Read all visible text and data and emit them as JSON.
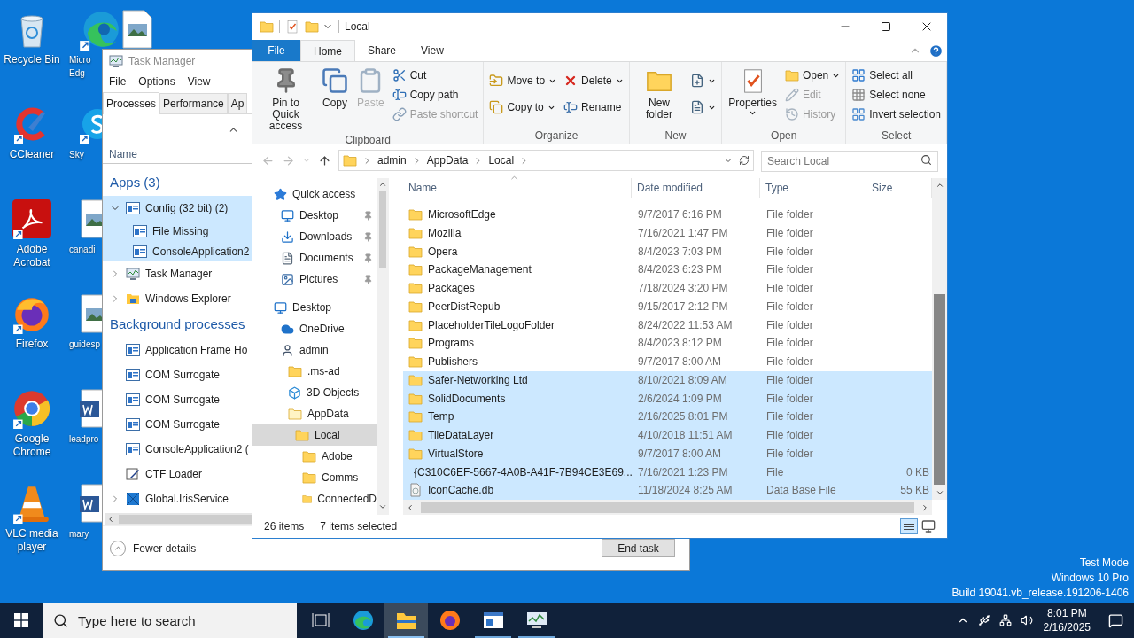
{
  "desktop": {
    "columns": [
      [
        {
          "label": "Recycle Bin",
          "kind": "recycle"
        },
        {
          "label": "CCleaner",
          "kind": "ccleaner"
        },
        {
          "label": "Adobe Acrobat",
          "kind": "acrobat"
        },
        {
          "label": "Firefox",
          "kind": "firefox"
        },
        {
          "label": "Google Chrome",
          "kind": "chrome"
        },
        {
          "label": "VLC media player",
          "kind": "vlc"
        }
      ],
      [
        {
          "label": "Micro Edg",
          "kind": "edge"
        },
        {
          "label": "Sky",
          "kind": "skype"
        },
        {
          "label": "canadi",
          "kind": "image"
        },
        {
          "label": "guidesp",
          "kind": "image"
        },
        {
          "label": "leadpro",
          "kind": "word"
        },
        {
          "label": "mary",
          "kind": "word"
        }
      ],
      [
        {
          "kind": "image"
        }
      ]
    ]
  },
  "task_manager": {
    "title": "Task Manager",
    "menu": [
      "File",
      "Options",
      "View"
    ],
    "tabs": [
      {
        "label": "Processes",
        "selected": true
      },
      {
        "label": "Performance",
        "selected": false
      },
      {
        "label": "Ap",
        "selected": false
      }
    ],
    "column": "Name",
    "sections": [
      {
        "title": "Apps (3)",
        "items": [
          {
            "name": "Config (32 bit) (2)",
            "kind": "app",
            "expandable": true,
            "expanded": true,
            "selected": true,
            "children": [
              {
                "name": "File Missing",
                "kind": "app"
              },
              {
                "name": "ConsoleApplication2",
                "kind": "app"
              }
            ]
          },
          {
            "name": "Task Manager",
            "kind": "taskmgr",
            "expandable": true,
            "expanded": false,
            "selected": false
          },
          {
            "name": "Windows Explorer",
            "kind": "explorer",
            "expandable": true,
            "expanded": false,
            "selected": false
          }
        ]
      },
      {
        "title": "Background processes",
        "items": [
          {
            "name": "Application Frame Ho",
            "kind": "app",
            "expandable": false,
            "expanded": false,
            "selected": false
          },
          {
            "name": "COM Surrogate",
            "kind": "app",
            "expandable": false,
            "expanded": false,
            "selected": false
          },
          {
            "name": "COM Surrogate",
            "kind": "app",
            "expandable": false,
            "expanded": false,
            "selected": false
          },
          {
            "name": "COM Surrogate",
            "kind": "app",
            "expandable": false,
            "expanded": false,
            "selected": false
          },
          {
            "name": "ConsoleApplication2 (",
            "kind": "app",
            "expandable": false,
            "expanded": false,
            "selected": false
          },
          {
            "name": "CTF Loader",
            "kind": "ctf",
            "expandable": false,
            "expanded": false,
            "selected": false
          },
          {
            "name": "Global.IrisService",
            "kind": "iris",
            "expandable": true,
            "expanded": false,
            "selected": false
          }
        ]
      }
    ],
    "footer": {
      "toggle": "Fewer details",
      "button": "End task"
    }
  },
  "explorer": {
    "title": "Local",
    "tabs": [
      {
        "label": "File",
        "kind": "file",
        "selected": false
      },
      {
        "label": "Home",
        "kind": "tab",
        "selected": true
      },
      {
        "label": "Share",
        "kind": "tab",
        "selected": false
      },
      {
        "label": "View",
        "kind": "tab",
        "selected": false
      }
    ],
    "ribbon": [
      {
        "label": "Clipboard",
        "large": [
          {
            "label": "Pin to Quick access",
            "kind": "pin",
            "disabled": false,
            "dropdown": false
          },
          {
            "label": "Copy",
            "kind": "copy",
            "disabled": false,
            "dropdown": false
          },
          {
            "label": "Paste",
            "kind": "paste",
            "disabled": true,
            "dropdown": false
          }
        ],
        "small": [
          [
            {
              "label": "Cut",
              "kind": "cut",
              "disabled": false,
              "dropdown": false
            },
            {
              "label": "Copy path",
              "kind": "path",
              "disabled": false,
              "dropdown": false
            },
            {
              "label": "Paste shortcut",
              "kind": "shortcut",
              "disabled": true,
              "dropdown": false
            }
          ]
        ]
      },
      {
        "label": "Organize",
        "small": [
          [
            {
              "label": "Move to",
              "kind": "move",
              "disabled": false,
              "dropdown": true
            },
            {
              "label": "Copy to",
              "kind": "copyto",
              "disabled": false,
              "dropdown": true
            }
          ],
          [
            {
              "label": "Delete",
              "kind": "delete",
              "disabled": false,
              "dropdown": true
            },
            {
              "label": "Rename",
              "kind": "rename",
              "disabled": false,
              "dropdown": false
            }
          ]
        ]
      },
      {
        "label": "New",
        "large": [
          {
            "label": "New folder",
            "kind": "newfolder",
            "disabled": false,
            "dropdown": false
          }
        ],
        "small": [
          [
            {
              "kind": "newitem",
              "disabled": false,
              "dropdown": true
            },
            {
              "kind": "easyaccess",
              "disabled": false,
              "dropdown": true
            }
          ]
        ]
      },
      {
        "label": "Open",
        "large": [
          {
            "label": "Properties",
            "kind": "properties",
            "disabled": false,
            "dropdown": true
          }
        ],
        "small": [
          [
            {
              "label": "Open",
              "kind": "open",
              "disabled": false,
              "dropdown": true
            },
            {
              "label": "Edit",
              "kind": "edit",
              "disabled": true,
              "dropdown": false
            },
            {
              "label": "History",
              "kind": "history",
              "disabled": true,
              "dropdown": false
            }
          ]
        ]
      },
      {
        "label": "Select",
        "small": [
          [
            {
              "label": "Select all",
              "kind": "selectall",
              "disabled": false,
              "dropdown": false
            },
            {
              "label": "Select none",
              "kind": "selectnone",
              "disabled": false,
              "dropdown": false
            },
            {
              "label": "Invert selection",
              "kind": "invert",
              "disabled": false,
              "dropdown": false
            }
          ]
        ]
      }
    ],
    "address": {
      "crumbs": [
        "admin",
        "AppData",
        "Local"
      ]
    },
    "search": {
      "placeholder": "Search Local"
    },
    "nav": [
      {
        "label": "Quick access",
        "kind": "star",
        "pinned": false,
        "selected": false,
        "children": [
          {
            "label": "Desktop",
            "kind": "desktop",
            "pinned": true,
            "selected": false
          },
          {
            "label": "Downloads",
            "kind": "download",
            "pinned": true,
            "selected": false
          },
          {
            "label": "Documents",
            "kind": "documents",
            "pinned": true,
            "selected": false
          },
          {
            "label": "Pictures",
            "kind": "pictures",
            "pinned": true,
            "selected": false
          }
        ]
      },
      {
        "label": "Desktop",
        "kind": "desktop",
        "pinned": false,
        "selected": false,
        "children": [
          {
            "label": "OneDrive",
            "kind": "cloud",
            "pinned": false,
            "selected": false
          },
          {
            "label": "admin",
            "kind": "user",
            "pinned": false,
            "selected": false,
            "children": [
              {
                "label": ".ms-ad",
                "kind": "folder",
                "pinned": false,
                "selected": false
              },
              {
                "label": "3D Objects",
                "kind": "cube",
                "pinned": false,
                "selected": false
              },
              {
                "label": "AppData",
                "kind": "folderlight",
                "pinned": false,
                "selected": false,
                "children": [
                  {
                    "label": "Local",
                    "kind": "folder",
                    "pinned": false,
                    "selected": true,
                    "children": [
                      {
                        "label": "Adobe",
                        "kind": "folder",
                        "pinned": false,
                        "selected": false
                      },
                      {
                        "label": "Comms",
                        "kind": "folder",
                        "pinned": false,
                        "selected": false
                      },
                      {
                        "label": "ConnectedD",
                        "kind": "folder",
                        "pinned": false,
                        "selected": false
                      }
                    ]
                  }
                ]
              }
            ]
          }
        ]
      }
    ],
    "files": {
      "columns": [
        "Name",
        "Date modified",
        "Type",
        "Size"
      ],
      "rows": [
        {
          "name": "MicrosoftEdge",
          "date": "9/7/2017 6:16 PM",
          "type": "File folder",
          "kind": "folder",
          "selected": false
        },
        {
          "name": "Mozilla",
          "date": "7/16/2021 1:47 PM",
          "type": "File folder",
          "kind": "folder",
          "selected": false
        },
        {
          "name": "Opera",
          "date": "8/4/2023 7:03 PM",
          "type": "File folder",
          "kind": "folder",
          "selected": false
        },
        {
          "name": "PackageManagement",
          "date": "8/4/2023 6:23 PM",
          "type": "File folder",
          "kind": "folder",
          "selected": false
        },
        {
          "name": "Packages",
          "date": "7/18/2024 3:20 PM",
          "type": "File folder",
          "kind": "folder",
          "selected": false
        },
        {
          "name": "PeerDistRepub",
          "date": "9/15/2017 2:12 PM",
          "type": "File folder",
          "kind": "folder",
          "selected": false
        },
        {
          "name": "PlaceholderTileLogoFolder",
          "date": "8/24/2022 11:53 AM",
          "type": "File folder",
          "kind": "folder",
          "selected": false
        },
        {
          "name": "Programs",
          "date": "8/4/2023 8:12 PM",
          "type": "File folder",
          "kind": "folder",
          "selected": false
        },
        {
          "name": "Publishers",
          "date": "9/7/2017 8:00 AM",
          "type": "File folder",
          "kind": "folder",
          "selected": false
        },
        {
          "name": "Safer-Networking Ltd",
          "date": "8/10/2021 8:09 AM",
          "type": "File folder",
          "kind": "folder",
          "selected": true
        },
        {
          "name": "SolidDocuments",
          "date": "2/6/2024 1:09 PM",
          "type": "File folder",
          "kind": "folder",
          "selected": true
        },
        {
          "name": "Temp",
          "date": "2/16/2025 8:01 PM",
          "type": "File folder",
          "kind": "folder",
          "selected": true
        },
        {
          "name": "TileDataLayer",
          "date": "4/10/2018 11:51 AM",
          "type": "File folder",
          "kind": "folder",
          "selected": true
        },
        {
          "name": "VirtualStore",
          "date": "9/7/2017 8:00 AM",
          "type": "File folder",
          "kind": "folder",
          "selected": true
        },
        {
          "name": "{C310C6EF-5667-4A0B-A41F-7B94CE3E69...",
          "date": "7/16/2021 1:23 PM",
          "type": "File",
          "size": "0 KB",
          "kind": "file",
          "selected": true
        },
        {
          "name": "IconCache.db",
          "date": "11/18/2024 8:25 AM",
          "type": "Data Base File",
          "size": "55 KB",
          "kind": "db",
          "selected": true
        }
      ]
    },
    "status": {
      "count": "26 items",
      "selection": "7 items selected"
    }
  },
  "taskbar": {
    "search": {
      "placeholder": "Type here to search"
    },
    "apps": [
      {
        "kind": "taskview",
        "active": false,
        "running": false
      },
      {
        "kind": "edge",
        "active": false,
        "running": false
      },
      {
        "kind": "explorer",
        "active": true,
        "running": true
      },
      {
        "kind": "firefox",
        "active": false,
        "running": false
      },
      {
        "kind": "window",
        "active": false,
        "running": true
      },
      {
        "kind": "taskmgr",
        "active": false,
        "running": true
      }
    ],
    "time": "8:01 PM",
    "date": "2/16/2025"
  },
  "system_text": [
    "Test Mode",
    "Windows 10 Pro",
    "Build 19041.vb_release.191206-1406"
  ]
}
